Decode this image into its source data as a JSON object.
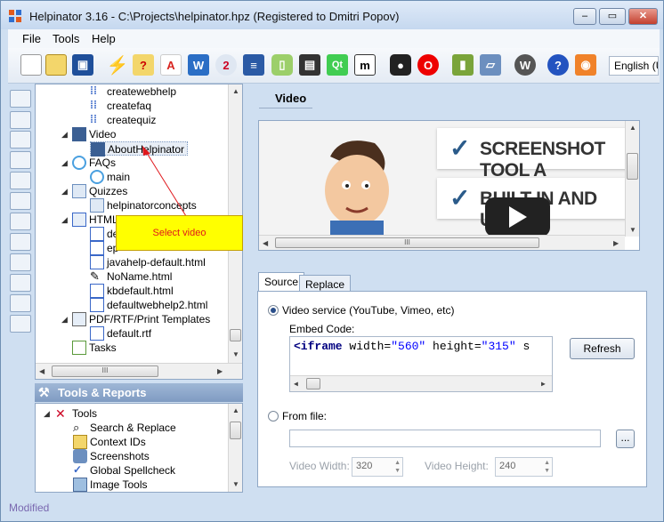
{
  "window": {
    "title": "Helpinator 3.16 - C:\\Projects\\helpinator.hpz (Registered to Dmitri Popov)",
    "minimize": "–",
    "restore": "▭",
    "close": "✕"
  },
  "menu": [
    "File",
    "Tools",
    "Help"
  ],
  "toolbar": {
    "icons": [
      "new-file-icon",
      "open-file-icon",
      "save-icon",
      "build-icon",
      "help-topic-icon",
      "pdf-icon",
      "word-icon",
      "chm-icon",
      "books-icon",
      "mobile-icon",
      "print-icon",
      "qt-icon",
      "markdown-icon",
      "github-icon",
      "opera-icon",
      "epub-icon",
      "ipad-icon",
      "wordpress-icon",
      "help-icon",
      "rss-icon"
    ],
    "language": "English (U"
  },
  "project_tree": {
    "items": [
      {
        "label": "createwebhelp",
        "icon": "steps-icon"
      },
      {
        "label": "createfaq",
        "icon": "steps-icon"
      },
      {
        "label": "createquiz",
        "icon": "steps-icon"
      },
      {
        "label": "Video",
        "icon": "film-icon"
      },
      {
        "label": "AboutHelpinator",
        "icon": "film-icon"
      },
      {
        "label": "FAQs",
        "icon": "faq-icon"
      },
      {
        "label": "main",
        "icon": "faq-icon"
      },
      {
        "label": "Quizzes",
        "icon": "quiz-icon"
      },
      {
        "label": "helpinatorconcepts",
        "icon": "quiz-icon"
      },
      {
        "label": "HTML",
        "icon": "html-icon"
      },
      {
        "label": "de",
        "icon": "page-icon"
      },
      {
        "label": "ep",
        "icon": "page-icon"
      },
      {
        "label": "javahelp-default.html",
        "icon": "page-icon"
      },
      {
        "label": "NoName.html",
        "icon": "pen-icon"
      },
      {
        "label": "kbdefault.html",
        "icon": "page-icon"
      },
      {
        "label": "defaultwebhelp2.html",
        "icon": "page-icon"
      },
      {
        "label": "PDF/RTF/Print Templates",
        "icon": "print-template-icon"
      },
      {
        "label": "default.rtf",
        "icon": "page-icon"
      },
      {
        "label": "Tasks",
        "icon": "tasks-icon"
      }
    ],
    "callout": "Select video"
  },
  "tools_reports": {
    "header": "Tools & Reports",
    "items": [
      {
        "label": "Tools",
        "icon": "tools-icon"
      },
      {
        "label": "Search & Replace",
        "icon": "search-icon"
      },
      {
        "label": "Context IDs",
        "icon": "context-icon"
      },
      {
        "label": "Screenshots",
        "icon": "camera-icon"
      },
      {
        "label": "Global Spellcheck",
        "icon": "spellcheck-icon"
      },
      {
        "label": "Image Tools",
        "icon": "image-icon"
      }
    ]
  },
  "editor": {
    "title": "Video",
    "preview": {
      "banner1": "SCREENSHOT TOOL A",
      "banner2": "BUILT-IN AND USER"
    },
    "tabs": [
      "Source",
      "Replace"
    ],
    "video_service_label": "Video service (YouTube, Vimeo, etc)",
    "embed_label": "Embed Code:",
    "embed_code": {
      "tag": "<iframe",
      "w_attr": " width=",
      "w_val": "\"560\"",
      "h_attr": " height=",
      "h_val": "\"315\"",
      "rest": " s"
    },
    "refresh_button": "Refresh",
    "from_file_label": "From file:",
    "file_value": "",
    "browse_button": "...",
    "width_label": "Video Width:",
    "width_value": "320",
    "height_label": "Video Height:",
    "height_value": "240"
  },
  "status": "Modified",
  "colors": {
    "accent": "#2a4e8a",
    "callout_bg": "#ffff00",
    "callout_text": "#e0171c",
    "code_keyword": "#000080",
    "code_string": "#0000ff"
  }
}
